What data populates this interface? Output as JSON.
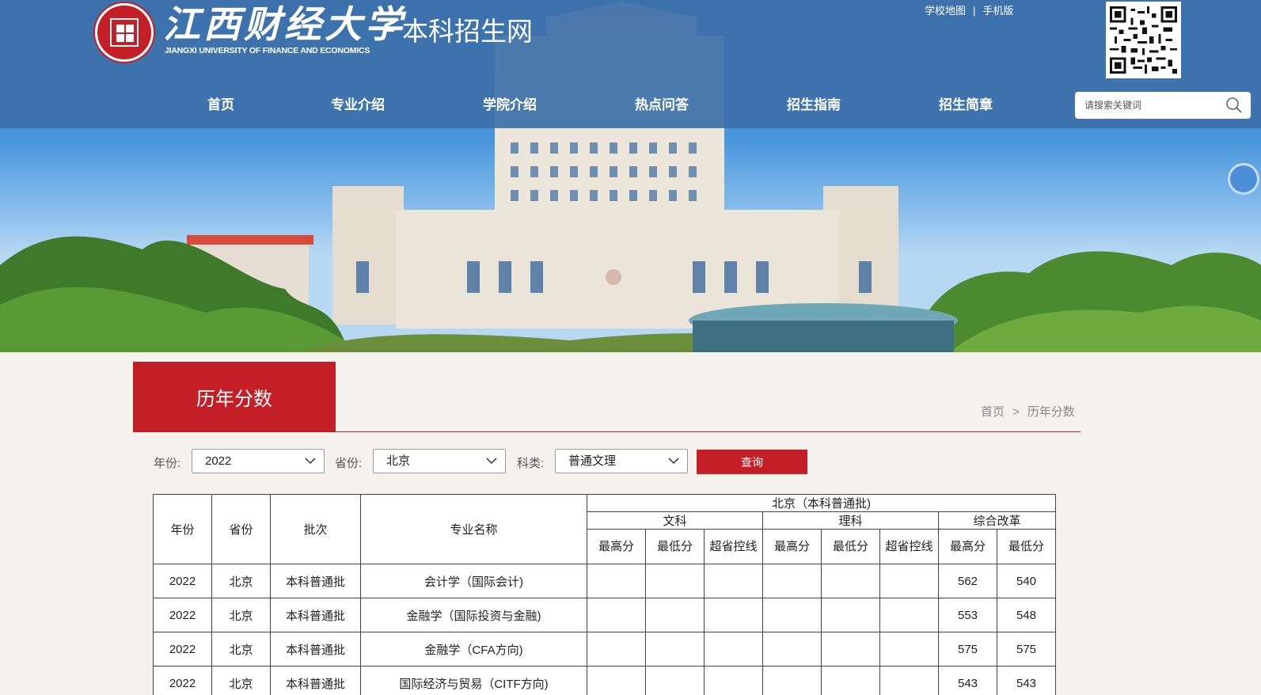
{
  "header": {
    "logo_cn": "江西财经大学",
    "logo_en": "JIANGXI UNIVERSITY OF FINANCE AND ECONOMICS",
    "site_name": "本科招生网",
    "links": [
      "学校地图",
      "手机版"
    ]
  },
  "nav": [
    "首页",
    "专业介绍",
    "学院介绍",
    "热点问答",
    "招生指南",
    "招生简章"
  ],
  "search": {
    "placeholder": "请搜索关键词"
  },
  "page": {
    "title": "历年分数",
    "breadcrumb": [
      "首页",
      "历年分数"
    ],
    "breadcrumb_sep": ">"
  },
  "filters": {
    "year_label": "年份:",
    "year_value": "2022",
    "province_label": "省份:",
    "province_value": "北京",
    "category_label": "科类:",
    "category_value": "普通文理",
    "query_label": "查询"
  },
  "table": {
    "group_title": "北京（本科普通批)",
    "fixed_headers": [
      "年份",
      "省份",
      "批次",
      "专业名称"
    ],
    "subjects": [
      "文科",
      "理科",
      "综合改革"
    ],
    "score_headers": [
      "最高分",
      "最低分",
      "超省控线",
      "最高分",
      "最低分",
      "超省控线",
      "最高分",
      "最低分"
    ],
    "rows": [
      [
        "2022",
        "北京",
        "本科普通批",
        "会计学（国际会计)",
        "",
        "",
        "",
        "",
        "",
        "",
        "562",
        "540"
      ],
      [
        "2022",
        "北京",
        "本科普通批",
        "金融学（国际投资与金融)",
        "",
        "",
        "",
        "",
        "",
        "",
        "553",
        "548"
      ],
      [
        "2022",
        "北京",
        "本科普通批",
        "金融学（CFA方向)",
        "",
        "",
        "",
        "",
        "",
        "",
        "575",
        "575"
      ],
      [
        "2022",
        "北京",
        "本科普通批",
        "国际经济与贸易（CITF方向)",
        "",
        "",
        "",
        "",
        "",
        "",
        "543",
        "543"
      ]
    ]
  },
  "colors": {
    "brand_red": "#c41e27",
    "header_blue": "#3e71aa"
  }
}
